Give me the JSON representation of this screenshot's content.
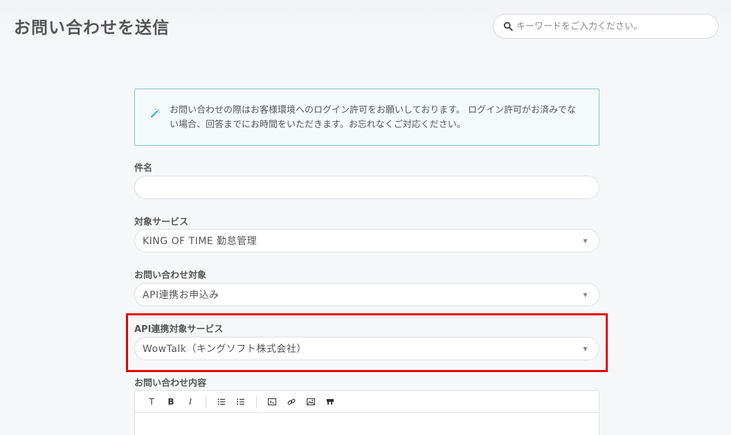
{
  "page": {
    "title": "お問い合わせを送信"
  },
  "search": {
    "placeholder": "キーワードをご入力ください。",
    "icon": "search-icon"
  },
  "notice": {
    "icon": "magic-wand-icon",
    "text": "お問い合わせの際はお客様環境へのログイン許可をお願いしております。 ログイン許可がお済みでない場合、回答までにお時間をいただきます。お忘れなくご対応ください。"
  },
  "form": {
    "subject": {
      "label": "件名",
      "value": ""
    },
    "service": {
      "label": "対象サービス",
      "value": "KING OF TIME 勤怠管理"
    },
    "inquiry_type": {
      "label": "お問い合わせ対象",
      "value": "API連携お申込み"
    },
    "api_service": {
      "label": "API連携対象サービス",
      "value": "WowTalk（キングソフト株式会社）"
    },
    "content": {
      "label": "お問い合わせ内容"
    }
  },
  "editor_toolbar": {
    "heading": "T",
    "bold": "B",
    "italic": "I",
    "icons": [
      "bullet-list-icon",
      "numbered-list-icon",
      "code-block-icon",
      "link-icon",
      "image-icon",
      "quote-icon"
    ]
  },
  "colors": {
    "highlight": "#e60000",
    "notice_border": "#7cc7d0",
    "notice_icon": "#3aaec4"
  }
}
